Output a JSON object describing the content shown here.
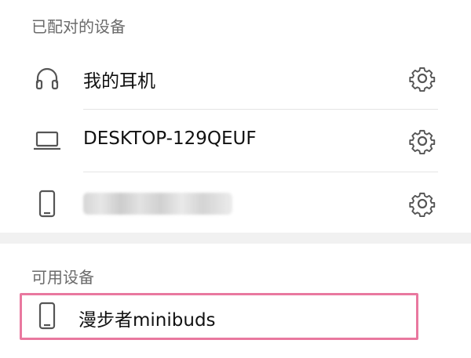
{
  "paired_section": {
    "header": "已配对的设备",
    "devices": [
      {
        "name": "我的耳机",
        "icon": "headphones-icon"
      },
      {
        "name": "DESKTOP-129QEUF",
        "icon": "laptop-icon"
      },
      {
        "name": "",
        "icon": "phone-icon",
        "name_blurred": true
      }
    ]
  },
  "available_section": {
    "header": "可用设备",
    "devices": [
      {
        "name": "漫步者minibuds",
        "icon": "phone-icon"
      }
    ]
  },
  "colors": {
    "highlight": "#e9789f",
    "section_header": "#6b6b6b",
    "icon": "#555555",
    "divider": "#e4e4e4",
    "section_band": "#f1f1f1"
  }
}
